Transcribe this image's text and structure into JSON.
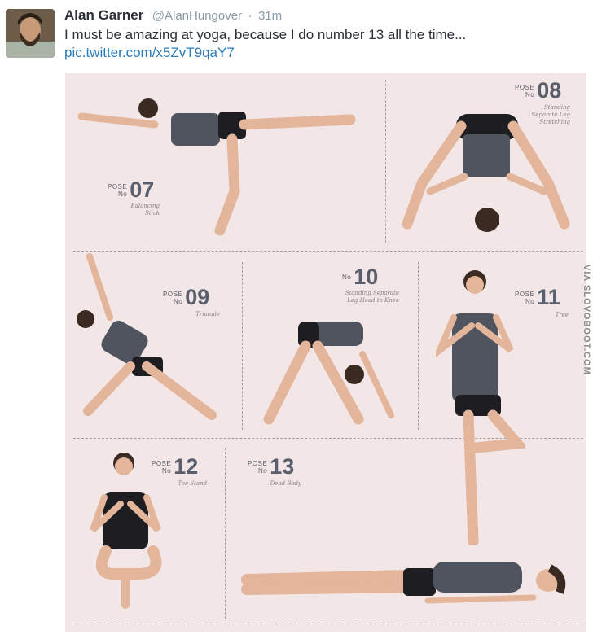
{
  "tweet": {
    "author_name": "Alan Garner",
    "handle": "@AlanHungover",
    "separator": "·",
    "time": "31m",
    "text": "I must be amazing at yoga, because I do number 13 all the time...",
    "link": "pic.twitter.com/x5ZvT9qaY7"
  },
  "poster": {
    "poses": [
      {
        "tag": "POSE\nNo",
        "number": "07",
        "name": "Balancing\nStick"
      },
      {
        "tag": "POSE\nNo",
        "number": "08",
        "name": "Standing\nSeparate Leg\nStretching"
      },
      {
        "tag": "POSE\nNo",
        "number": "09",
        "name": "Triangle"
      },
      {
        "tag": "No",
        "number": "10",
        "name": "Standing Separate\nLeg Head to Knee"
      },
      {
        "tag": "POSE\nNo",
        "number": "11",
        "name": "Tree"
      },
      {
        "tag": "POSE\nNo",
        "number": "12",
        "name": "Toe Stand"
      },
      {
        "tag": "POSE\nNo",
        "number": "13",
        "name": "Dead Body"
      }
    ]
  },
  "watermark": "VIA SLOVOBOOT.COM",
  "colors": {
    "poster_bg": "#f2e6e6",
    "link": "#2b7bb9",
    "outfit": "#4f545e",
    "skin": "#e3b59a"
  }
}
